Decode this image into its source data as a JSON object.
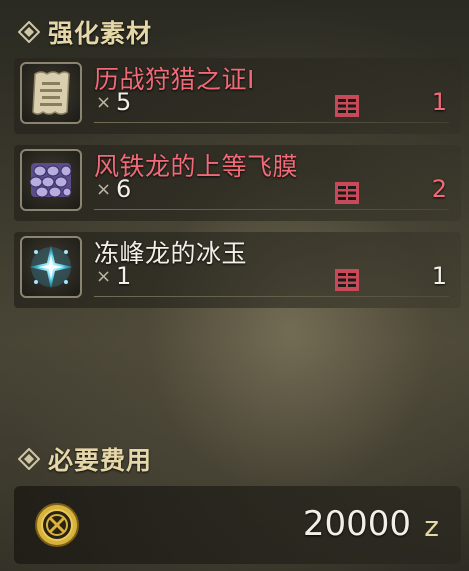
{
  "materials_section": {
    "title": "强化素材",
    "icon": "diamond-emblem-icon"
  },
  "materials": [
    {
      "name": "历战狩猎之证Ⅰ",
      "qty_prefix": "×",
      "required": "5",
      "owned": "1",
      "sufficient": false,
      "icon": "scroll-certificate-icon",
      "box_icon": "item-box-icon"
    },
    {
      "name": "风铁龙的上等飞膜",
      "qty_prefix": "×",
      "required": "6",
      "owned": "2",
      "sufficient": false,
      "icon": "wing-membrane-icon",
      "box_icon": "item-box-icon"
    },
    {
      "name": "冻峰龙的冰玉",
      "qty_prefix": "×",
      "required": "1",
      "owned": "1",
      "sufficient": true,
      "icon": "ice-jewel-icon",
      "box_icon": "item-box-icon"
    }
  ],
  "cost_section": {
    "title": "必要费用",
    "icon": "diamond-emblem-icon"
  },
  "cost": {
    "amount": "20000",
    "unit": "z",
    "icon": "zenny-coin-icon"
  },
  "colors": {
    "insufficient": "#f06a78",
    "sufficient": "#f2efe6",
    "header_gold": "#e6d7a8",
    "box_red": "#c84a5a"
  }
}
